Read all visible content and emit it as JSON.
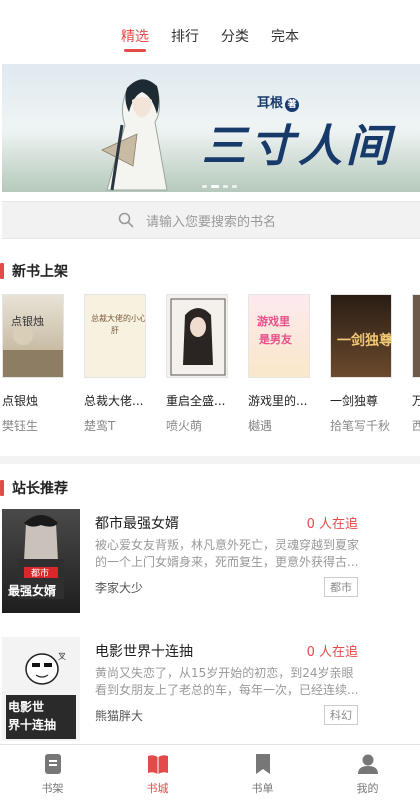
{
  "top_tabs": [
    {
      "label": "精选"
    },
    {
      "label": "排行"
    },
    {
      "label": "分类"
    },
    {
      "label": "完本"
    }
  ],
  "banner": {
    "title": "三寸人间",
    "author": "耳根",
    "author_seal": "著"
  },
  "search": {
    "placeholder": "请输入您要搜索的书名"
  },
  "new_books": {
    "section_title": "新书上架",
    "items": [
      {
        "title": "点银烛",
        "author": "樊钰生"
      },
      {
        "title": "总裁大佬...",
        "author": "楚鸾T"
      },
      {
        "title": "重启全盛...",
        "author": "喷火萌"
      },
      {
        "title": "游戏里的...",
        "author": "樾遇"
      },
      {
        "title": "一剑独尊",
        "author": "拾笔写千秋"
      },
      {
        "title": "万",
        "author": "西"
      }
    ]
  },
  "recommend": {
    "section_title": "站长推荐",
    "items": [
      {
        "title": "都市最强女婿",
        "reading": "0 人在追",
        "desc": "被心爱女友背叛，林凡意外死亡，灵魂穿越到夏家的一个上门女婿身来，死而复生，更意外获得古...",
        "author": "李家大少",
        "tag": "都市",
        "cover_text": "都市"
      },
      {
        "title": "电影世界十连抽",
        "reading": "0 人在追",
        "desc": "黄尚又失恋了，从15岁开始的初恋，到24岁亲眼看到女朋友上了老总的车，每年一次，已经连续...",
        "author": "熊猫胖大",
        "tag": "科幻",
        "cover_text": "电影世界十连抽"
      }
    ]
  },
  "bottom_nav": [
    {
      "label": "书架",
      "icon": "bookshelf-icon"
    },
    {
      "label": "书城",
      "icon": "bookstore-icon",
      "active": true
    },
    {
      "label": "书单",
      "icon": "booklist-icon"
    },
    {
      "label": "我的",
      "icon": "profile-icon"
    }
  ],
  "colors": {
    "accent": "#e34b4b"
  }
}
